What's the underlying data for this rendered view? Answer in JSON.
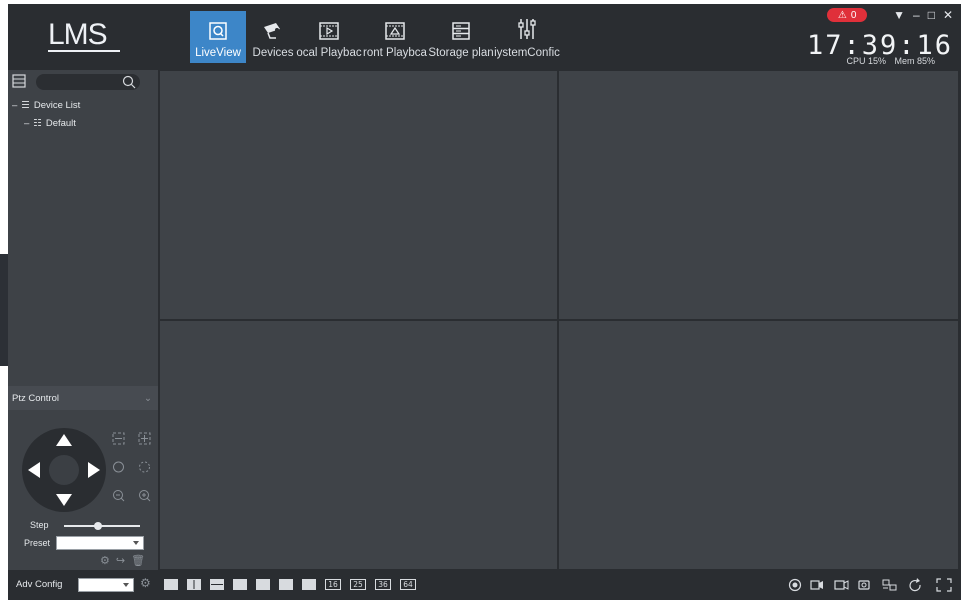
{
  "app": {
    "logo": "LMS"
  },
  "tabs": [
    {
      "label": "LiveView",
      "icon": "liveview-icon"
    },
    {
      "label": "Devices",
      "icon": "camera-icon"
    },
    {
      "label": "ocal Playbac",
      "icon": "local-playback-icon"
    },
    {
      "label": "ront Playbca",
      "icon": "front-playback-icon"
    },
    {
      "label": "Storage plan",
      "icon": "storage-icon"
    },
    {
      "label": "iystemConfic",
      "icon": "system-config-icon"
    }
  ],
  "status": {
    "alarm_count": "0",
    "clock": "17:39:16",
    "cpu": "CPU 15%",
    "mem": "Mem 85%"
  },
  "tree": {
    "root": "Device List",
    "child": "Default"
  },
  "ptz": {
    "header": "Ptz Control",
    "step_label": "Step",
    "preset_label": "Preset",
    "step_value": 0.45
  },
  "bottom": {
    "adv_config_label": "Adv Config",
    "layout_numbers": [
      "16",
      "25",
      "36",
      "64"
    ]
  },
  "colors": {
    "accent": "#3d86c8",
    "alarm": "#e0303a",
    "panel": "#3e4247",
    "bar": "#2a2d31"
  }
}
